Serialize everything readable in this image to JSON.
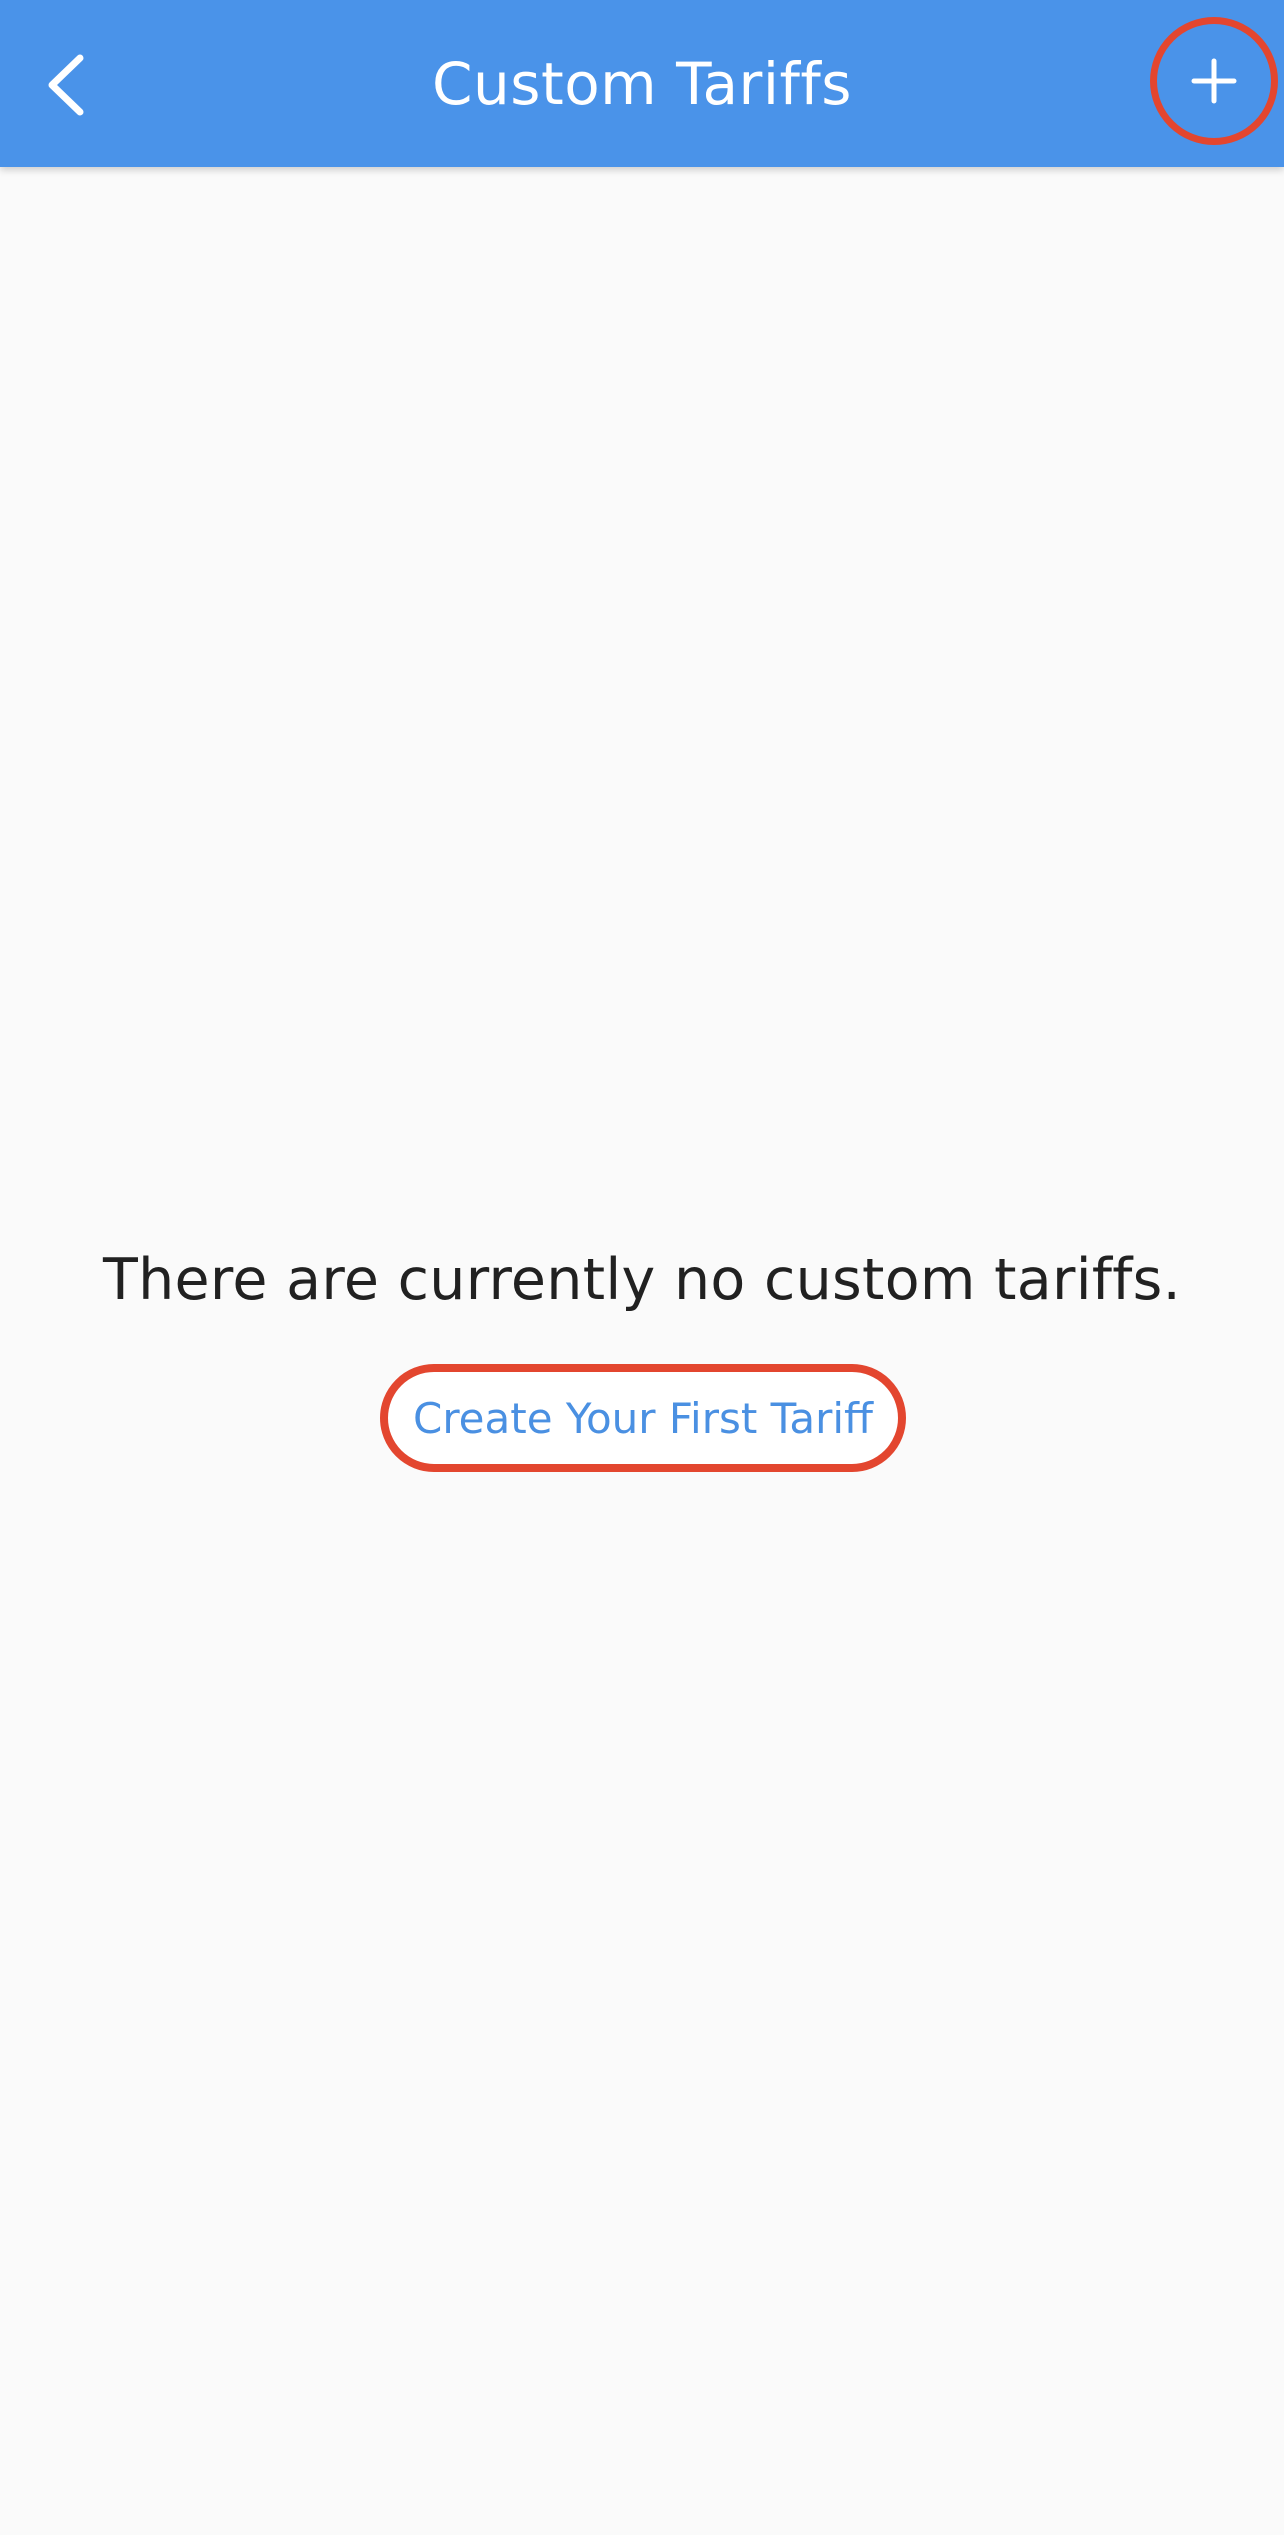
{
  "app_bar": {
    "title": "Custom Tariffs",
    "back_icon": "chevron-left-icon",
    "add_icon": "plus-icon",
    "background_color": "#4a93e9"
  },
  "empty_state": {
    "message": "There are currently no custom tariffs.",
    "create_button_label": "Create Your First Tariff",
    "link_color": "#4a90e2"
  },
  "highlight_color": "#e3462f"
}
